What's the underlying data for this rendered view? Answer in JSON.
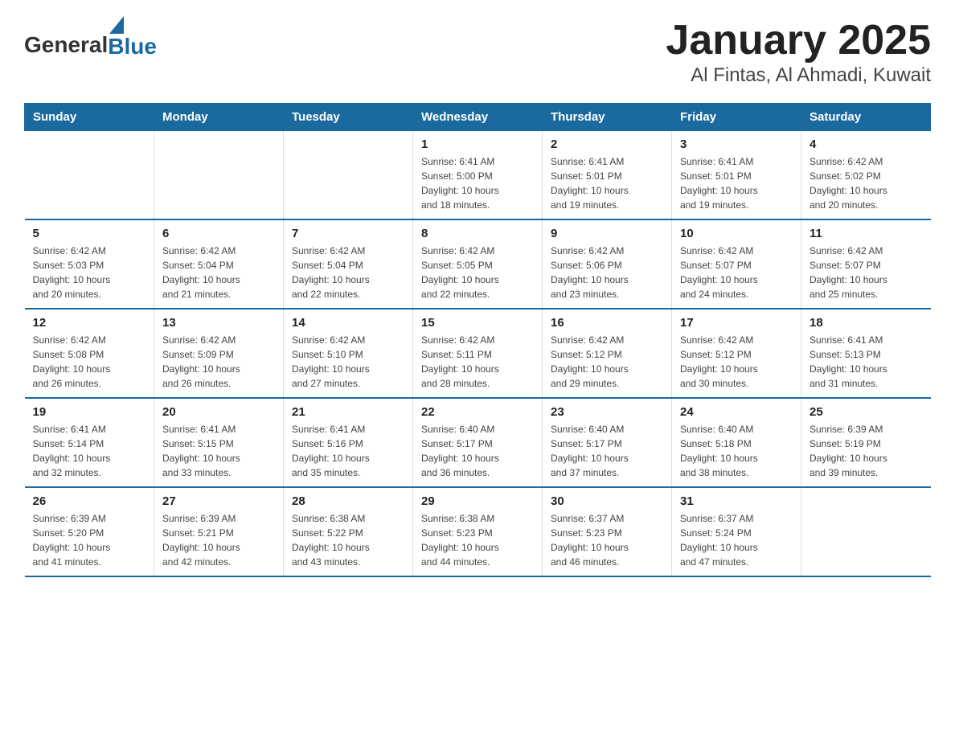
{
  "header": {
    "logo_general": "General",
    "logo_blue": "Blue",
    "title": "January 2025",
    "subtitle": "Al Fintas, Al Ahmadi, Kuwait"
  },
  "days_of_week": [
    "Sunday",
    "Monday",
    "Tuesday",
    "Wednesday",
    "Thursday",
    "Friday",
    "Saturday"
  ],
  "weeks": [
    [
      {
        "day": "",
        "info": ""
      },
      {
        "day": "",
        "info": ""
      },
      {
        "day": "",
        "info": ""
      },
      {
        "day": "1",
        "info": "Sunrise: 6:41 AM\nSunset: 5:00 PM\nDaylight: 10 hours\nand 18 minutes."
      },
      {
        "day": "2",
        "info": "Sunrise: 6:41 AM\nSunset: 5:01 PM\nDaylight: 10 hours\nand 19 minutes."
      },
      {
        "day": "3",
        "info": "Sunrise: 6:41 AM\nSunset: 5:01 PM\nDaylight: 10 hours\nand 19 minutes."
      },
      {
        "day": "4",
        "info": "Sunrise: 6:42 AM\nSunset: 5:02 PM\nDaylight: 10 hours\nand 20 minutes."
      }
    ],
    [
      {
        "day": "5",
        "info": "Sunrise: 6:42 AM\nSunset: 5:03 PM\nDaylight: 10 hours\nand 20 minutes."
      },
      {
        "day": "6",
        "info": "Sunrise: 6:42 AM\nSunset: 5:04 PM\nDaylight: 10 hours\nand 21 minutes."
      },
      {
        "day": "7",
        "info": "Sunrise: 6:42 AM\nSunset: 5:04 PM\nDaylight: 10 hours\nand 22 minutes."
      },
      {
        "day": "8",
        "info": "Sunrise: 6:42 AM\nSunset: 5:05 PM\nDaylight: 10 hours\nand 22 minutes."
      },
      {
        "day": "9",
        "info": "Sunrise: 6:42 AM\nSunset: 5:06 PM\nDaylight: 10 hours\nand 23 minutes."
      },
      {
        "day": "10",
        "info": "Sunrise: 6:42 AM\nSunset: 5:07 PM\nDaylight: 10 hours\nand 24 minutes."
      },
      {
        "day": "11",
        "info": "Sunrise: 6:42 AM\nSunset: 5:07 PM\nDaylight: 10 hours\nand 25 minutes."
      }
    ],
    [
      {
        "day": "12",
        "info": "Sunrise: 6:42 AM\nSunset: 5:08 PM\nDaylight: 10 hours\nand 26 minutes."
      },
      {
        "day": "13",
        "info": "Sunrise: 6:42 AM\nSunset: 5:09 PM\nDaylight: 10 hours\nand 26 minutes."
      },
      {
        "day": "14",
        "info": "Sunrise: 6:42 AM\nSunset: 5:10 PM\nDaylight: 10 hours\nand 27 minutes."
      },
      {
        "day": "15",
        "info": "Sunrise: 6:42 AM\nSunset: 5:11 PM\nDaylight: 10 hours\nand 28 minutes."
      },
      {
        "day": "16",
        "info": "Sunrise: 6:42 AM\nSunset: 5:12 PM\nDaylight: 10 hours\nand 29 minutes."
      },
      {
        "day": "17",
        "info": "Sunrise: 6:42 AM\nSunset: 5:12 PM\nDaylight: 10 hours\nand 30 minutes."
      },
      {
        "day": "18",
        "info": "Sunrise: 6:41 AM\nSunset: 5:13 PM\nDaylight: 10 hours\nand 31 minutes."
      }
    ],
    [
      {
        "day": "19",
        "info": "Sunrise: 6:41 AM\nSunset: 5:14 PM\nDaylight: 10 hours\nand 32 minutes."
      },
      {
        "day": "20",
        "info": "Sunrise: 6:41 AM\nSunset: 5:15 PM\nDaylight: 10 hours\nand 33 minutes."
      },
      {
        "day": "21",
        "info": "Sunrise: 6:41 AM\nSunset: 5:16 PM\nDaylight: 10 hours\nand 35 minutes."
      },
      {
        "day": "22",
        "info": "Sunrise: 6:40 AM\nSunset: 5:17 PM\nDaylight: 10 hours\nand 36 minutes."
      },
      {
        "day": "23",
        "info": "Sunrise: 6:40 AM\nSunset: 5:17 PM\nDaylight: 10 hours\nand 37 minutes."
      },
      {
        "day": "24",
        "info": "Sunrise: 6:40 AM\nSunset: 5:18 PM\nDaylight: 10 hours\nand 38 minutes."
      },
      {
        "day": "25",
        "info": "Sunrise: 6:39 AM\nSunset: 5:19 PM\nDaylight: 10 hours\nand 39 minutes."
      }
    ],
    [
      {
        "day": "26",
        "info": "Sunrise: 6:39 AM\nSunset: 5:20 PM\nDaylight: 10 hours\nand 41 minutes."
      },
      {
        "day": "27",
        "info": "Sunrise: 6:39 AM\nSunset: 5:21 PM\nDaylight: 10 hours\nand 42 minutes."
      },
      {
        "day": "28",
        "info": "Sunrise: 6:38 AM\nSunset: 5:22 PM\nDaylight: 10 hours\nand 43 minutes."
      },
      {
        "day": "29",
        "info": "Sunrise: 6:38 AM\nSunset: 5:23 PM\nDaylight: 10 hours\nand 44 minutes."
      },
      {
        "day": "30",
        "info": "Sunrise: 6:37 AM\nSunset: 5:23 PM\nDaylight: 10 hours\nand 46 minutes."
      },
      {
        "day": "31",
        "info": "Sunrise: 6:37 AM\nSunset: 5:24 PM\nDaylight: 10 hours\nand 47 minutes."
      },
      {
        "day": "",
        "info": ""
      }
    ]
  ]
}
